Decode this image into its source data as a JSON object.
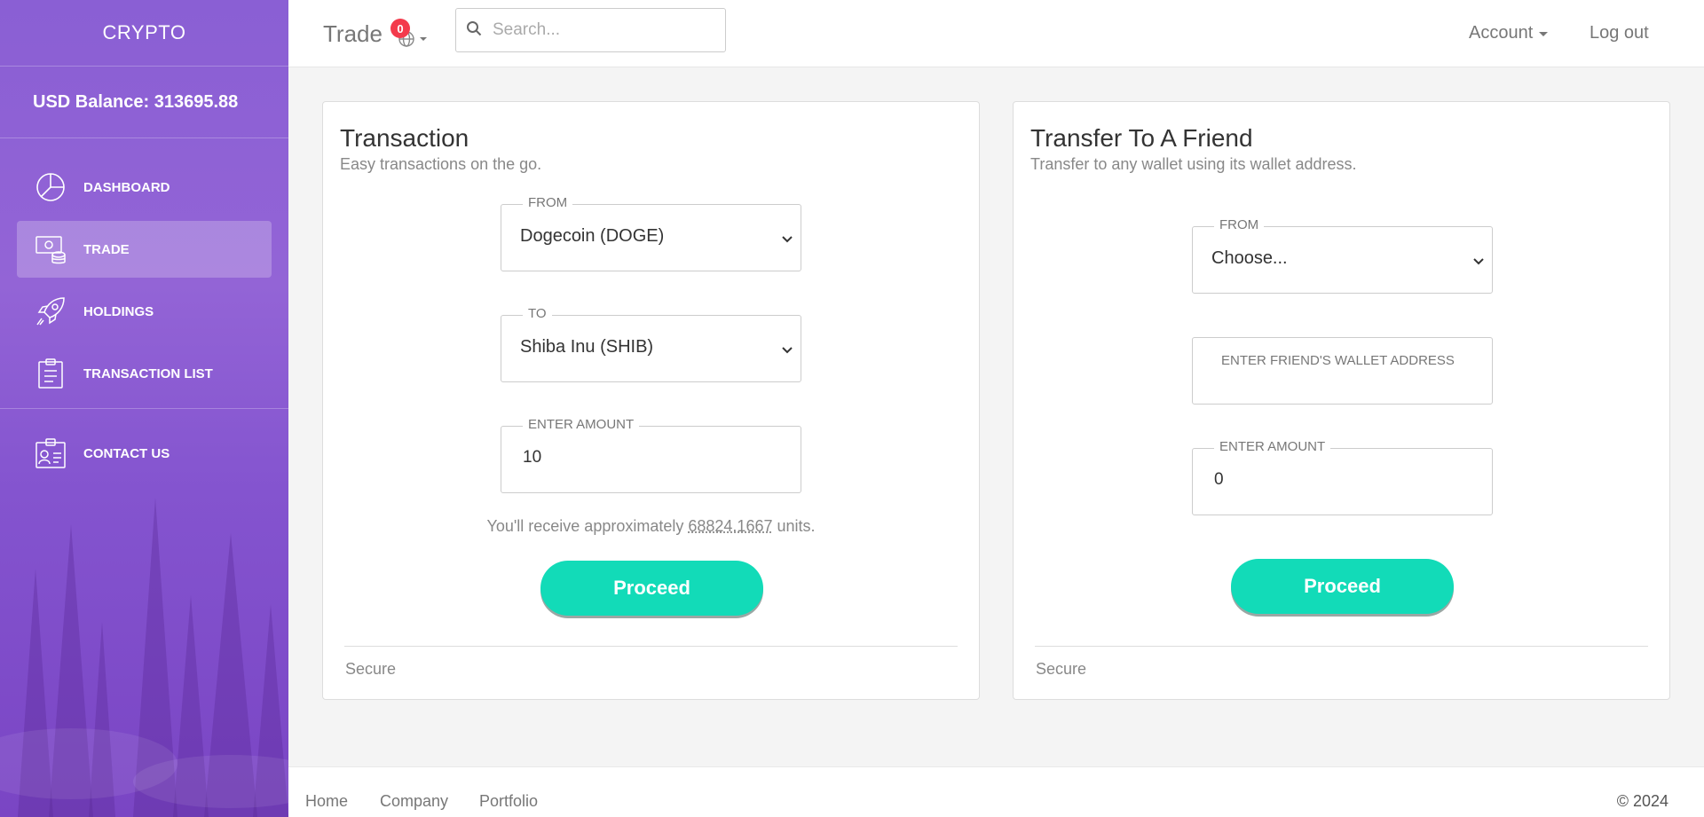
{
  "sidebar": {
    "brand": "CRYPTO",
    "balance": "USD Balance: 313695.88",
    "items": [
      {
        "label": "DASHBOARD",
        "icon": "pie-chart-icon"
      },
      {
        "label": "TRADE",
        "icon": "money-coins-icon",
        "active": true
      },
      {
        "label": "HOLDINGS",
        "icon": "rocket-icon"
      },
      {
        "label": "TRANSACTION LIST",
        "icon": "clipboard-icon"
      },
      {
        "label": "CONTACT US",
        "icon": "id-badge-icon"
      }
    ]
  },
  "topbar": {
    "title": "Trade",
    "notification_count": "0",
    "search_placeholder": "Search...",
    "account": "Account",
    "logout": "Log out"
  },
  "transaction": {
    "title": "Transaction",
    "subtitle": "Easy transactions on the go.",
    "from_label": "FROM",
    "from_value": "Dogecoin (DOGE)",
    "to_label": "TO",
    "to_value": "Shiba Inu (SHIB)",
    "amount_label": "ENTER AMOUNT",
    "amount_value": "10",
    "receive_prefix": "You'll receive approximately",
    "receive_amount": "68824.1667",
    "receive_suffix": "units.",
    "proceed": "Proceed",
    "footer": "Secure"
  },
  "transfer": {
    "title": "Transfer To A Friend",
    "subtitle": "Transfer to any wallet using its wallet address.",
    "from_label": "FROM",
    "from_value": "Choose...",
    "wallet_placeholder": "ENTER FRIEND'S WALLET ADDRESS",
    "amount_label": "ENTER AMOUNT",
    "amount_value": "0",
    "proceed": "Proceed",
    "footer": "Secure"
  },
  "footer": {
    "links": [
      "Home",
      "Company",
      "Portfolio"
    ],
    "copyright": "© 2024"
  },
  "colors": {
    "sidebar": "#8a5fd4",
    "accent": "#12dbb8",
    "badge": "#f33a4c"
  }
}
